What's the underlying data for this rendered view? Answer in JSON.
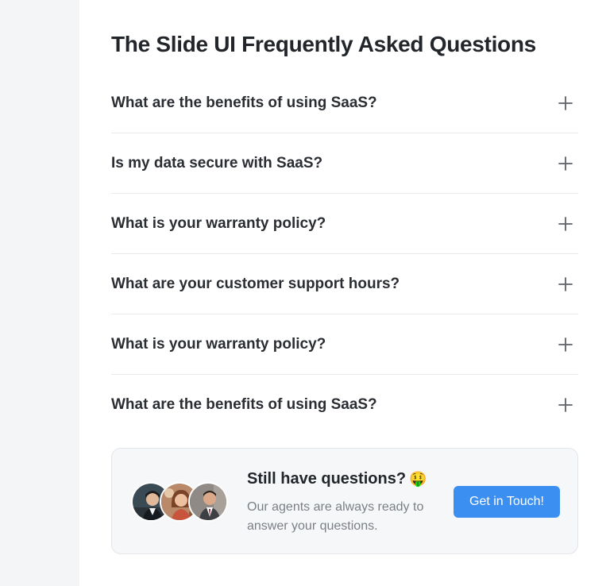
{
  "page": {
    "title": "The Slide UI Frequently Asked Questions"
  },
  "faq": {
    "items": [
      {
        "question": "What are the benefits of using SaaS?",
        "icon": "plus-icon"
      },
      {
        "question": "Is my data secure with SaaS?",
        "icon": "plus-icon"
      },
      {
        "question": "What is your warranty policy?",
        "icon": "plus-icon"
      },
      {
        "question": "What are your customer support hours?",
        "icon": "plus-icon"
      },
      {
        "question": "What is your warranty policy?",
        "icon": "plus-icon"
      },
      {
        "question": "What are the benefits of using SaaS?",
        "icon": "plus-icon"
      }
    ]
  },
  "cta": {
    "title": "Still have questions?",
    "emoji": "🤑",
    "description": "Our agents are always ready to answer your questions.",
    "button_label": "Get in Touch!",
    "avatars": [
      "agent-avatar-1",
      "agent-avatar-2",
      "agent-avatar-3"
    ]
  },
  "colors": {
    "accent": "#3b8ff0",
    "divider": "#e8eaed",
    "card_bg": "#f6f7f9",
    "rail_bg": "#f4f5f7"
  }
}
